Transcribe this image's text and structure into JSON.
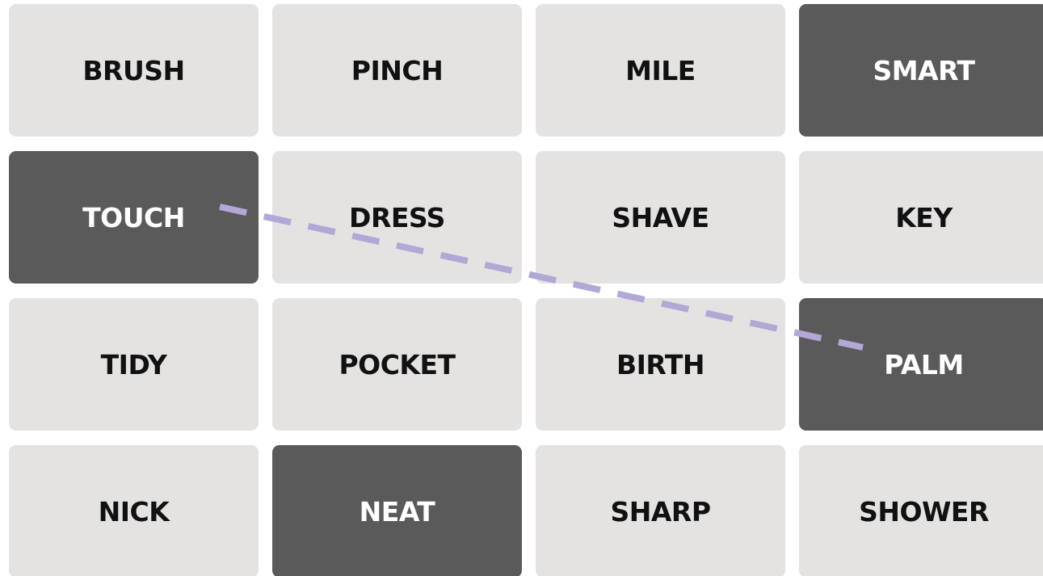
{
  "tiles": [
    {
      "word": "BRUSH",
      "selected": false
    },
    {
      "word": "PINCH",
      "selected": false
    },
    {
      "word": "MILE",
      "selected": false
    },
    {
      "word": "SMART",
      "selected": true
    },
    {
      "word": "TOUCH",
      "selected": true
    },
    {
      "word": "DRESS",
      "selected": false
    },
    {
      "word": "SHAVE",
      "selected": false
    },
    {
      "word": "KEY",
      "selected": false
    },
    {
      "word": "TIDY",
      "selected": false
    },
    {
      "word": "POCKET",
      "selected": false
    },
    {
      "word": "BIRTH",
      "selected": false
    },
    {
      "word": "PALM",
      "selected": true
    },
    {
      "word": "NICK",
      "selected": false
    },
    {
      "word": "NEAT",
      "selected": true
    },
    {
      "word": "SHARP",
      "selected": false
    },
    {
      "word": "SHOWER",
      "selected": false
    }
  ],
  "connector": {
    "from": "TOUCH",
    "to": "PALM",
    "color": "#b3a7d6",
    "style": "dashed"
  },
  "colors": {
    "tile_default": "#e5e3e1",
    "tile_selected": "#5a5a5a"
  }
}
